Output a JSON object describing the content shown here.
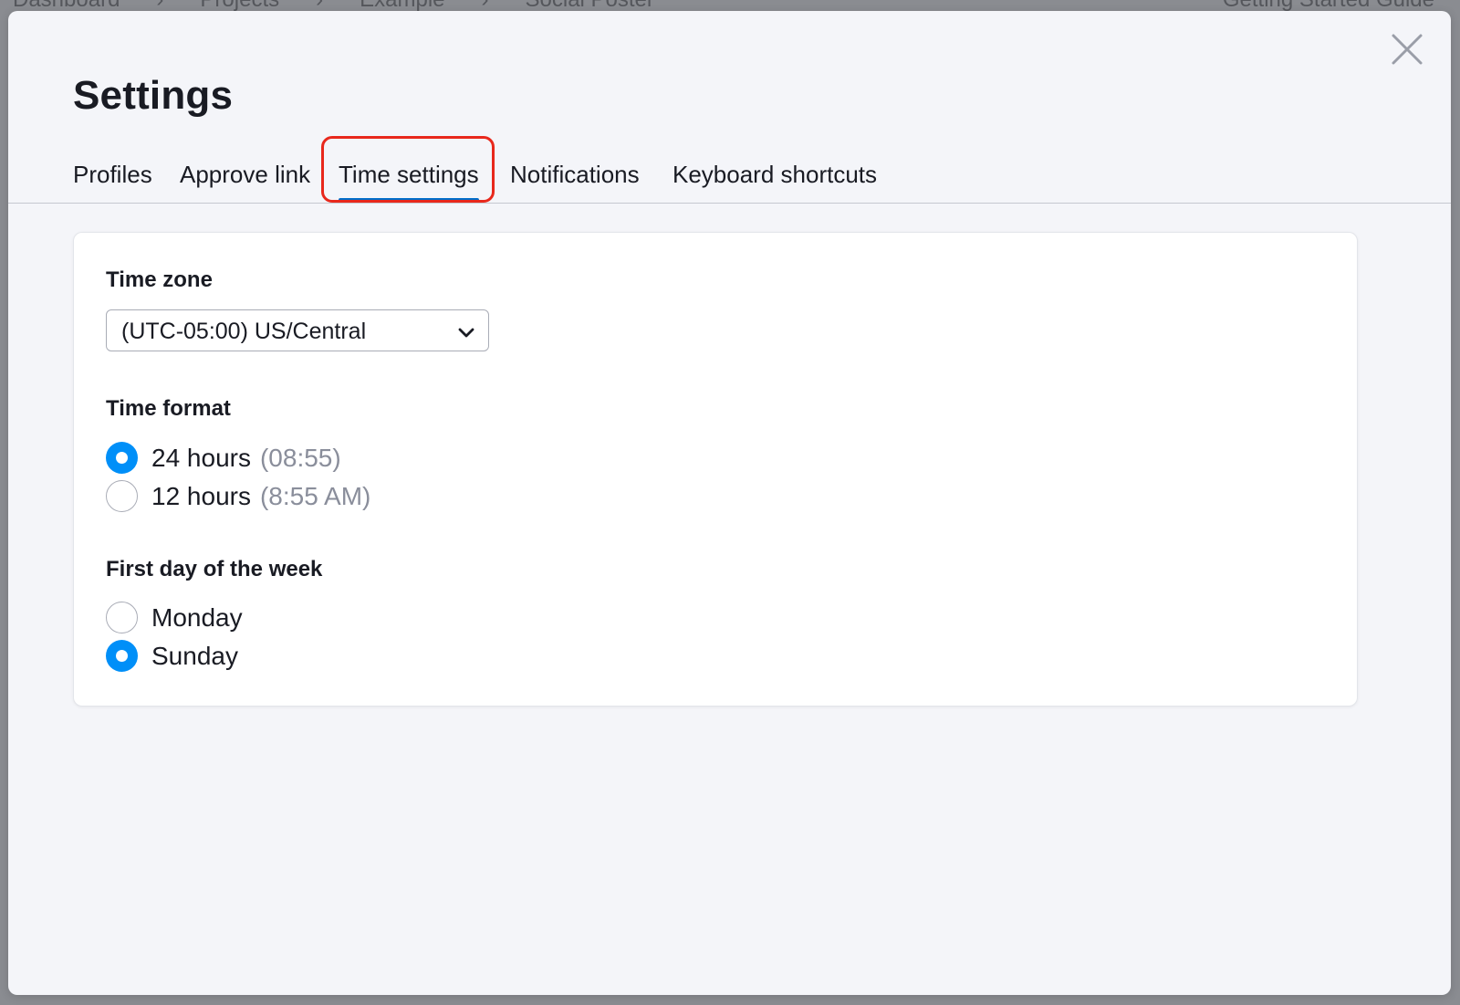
{
  "background": {
    "breadcrumb": [
      "Dashboard",
      "Projects",
      "Example",
      "Social Poster"
    ],
    "guide_link": "Getting Started Guide"
  },
  "modal": {
    "title": "Settings",
    "close_icon": "close-icon",
    "tabs": [
      {
        "label": "Profiles",
        "active": false
      },
      {
        "label": "Approve link",
        "active": false
      },
      {
        "label": "Time settings",
        "active": true
      },
      {
        "label": "Notifications",
        "active": false
      },
      {
        "label": "Keyboard shortcuts",
        "active": false
      }
    ],
    "highlight_color": "#e8281c",
    "accent_color": "#008ff8"
  },
  "time_zone": {
    "label": "Time zone",
    "selected": "(UTC-05:00) US/Central",
    "icon": "chevron-down-icon"
  },
  "time_format": {
    "label": "Time format",
    "options": [
      {
        "label": "24 hours",
        "hint": "(08:55)",
        "checked": true
      },
      {
        "label": "12 hours",
        "hint": "(8:55 AM)",
        "checked": false
      }
    ]
  },
  "first_day": {
    "label": "First day of the week",
    "options": [
      {
        "label": "Monday",
        "checked": false
      },
      {
        "label": "Sunday",
        "checked": true
      }
    ]
  }
}
